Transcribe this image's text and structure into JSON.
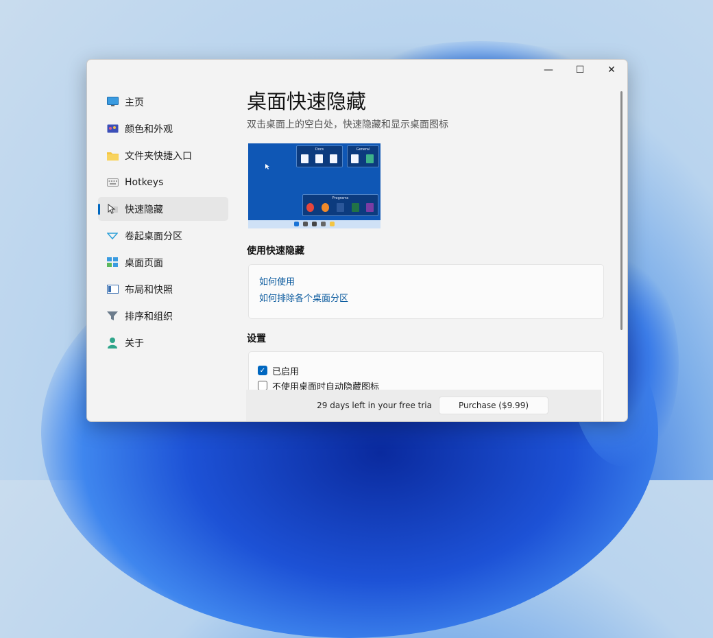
{
  "window": {
    "minimize_glyph": "—",
    "maximize_glyph": "☐",
    "close_glyph": "✕"
  },
  "sidebar": {
    "items": [
      {
        "label": "主页",
        "icon": "monitor-icon"
      },
      {
        "label": "颜色和外观",
        "icon": "palette-icon"
      },
      {
        "label": "文件夹快捷入口",
        "icon": "folder-icon"
      },
      {
        "label": "Hotkeys",
        "icon": "keyboard-icon"
      },
      {
        "label": "快速隐藏",
        "icon": "hide-cursor-icon"
      },
      {
        "label": "卷起桌面分区",
        "icon": "rollup-icon"
      },
      {
        "label": "桌面页面",
        "icon": "pages-icon"
      },
      {
        "label": "布局和快照",
        "icon": "layout-icon"
      },
      {
        "label": "排序和组织",
        "icon": "filter-icon"
      },
      {
        "label": "关于",
        "icon": "person-icon"
      }
    ],
    "selected_index": 4
  },
  "page": {
    "title": "桌面快速隐藏",
    "subtitle": "双击桌面上的空白处，快速隐藏和显示桌面图标"
  },
  "preview": {
    "group1_title": "Docs",
    "group2_title": "General",
    "group3_title": "Programs"
  },
  "usage": {
    "title": "使用快速隐藏",
    "link1": "如何使用",
    "link2": "如何排除各个桌面分区"
  },
  "settings": {
    "title": "设置",
    "option1": "已启用",
    "option1_checked": true,
    "option2": "不使用桌面时自动隐藏图标",
    "option2_checked": false
  },
  "footer": {
    "trial_text": "29 days left in your free tria",
    "purchase_label": "Purchase ($9.99)"
  },
  "colors": {
    "accent": "#0067c0",
    "link": "#0a5a9e"
  }
}
